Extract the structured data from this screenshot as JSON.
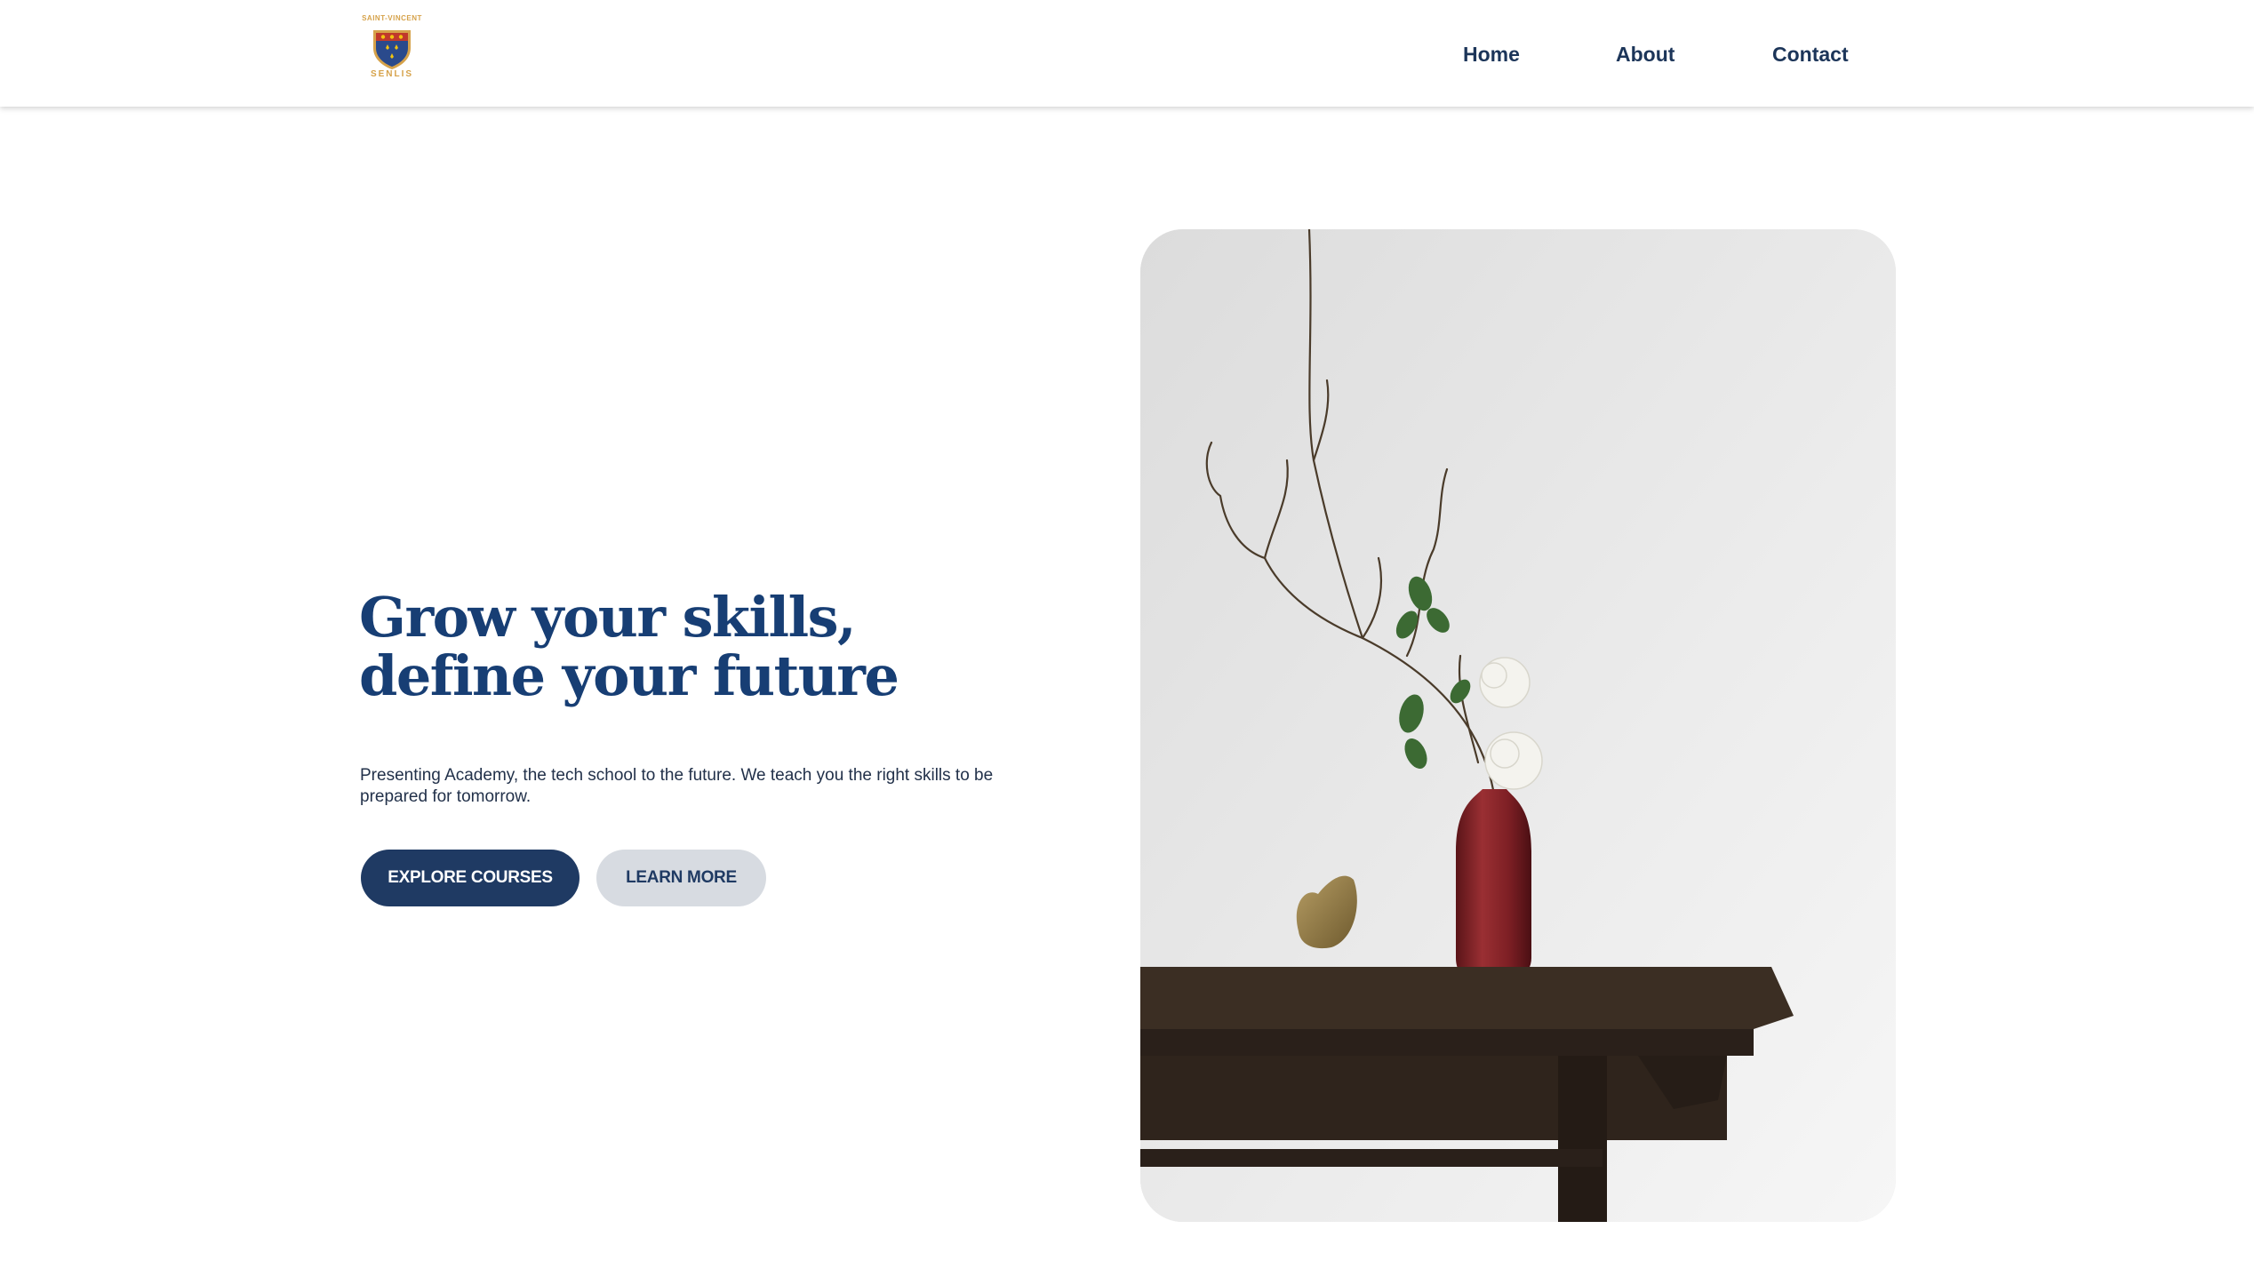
{
  "header": {
    "logo": {
      "top_text": "SAINT-VINCENT",
      "bottom_text": "SENLIS",
      "icon": "school-crest-icon"
    },
    "nav": [
      {
        "label": "Home"
      },
      {
        "label": "About"
      },
      {
        "label": "Contact"
      }
    ]
  },
  "hero": {
    "title_line1": "Grow your skills,",
    "title_line2": "define your future",
    "subtitle": "Presenting Academy, the tech school to the future. We teach you the right skills to be prepared for tomorrow.",
    "primary_button": "EXPLORE COURSES",
    "secondary_button": "LEARN MORE",
    "image": "vase-with-branch-and-roses-on-wooden-table"
  },
  "colors": {
    "primary": "#1f3a63",
    "title": "#173e74",
    "secondary_button_bg": "#d7dbe1",
    "logo_gold": "#d6a24a"
  }
}
